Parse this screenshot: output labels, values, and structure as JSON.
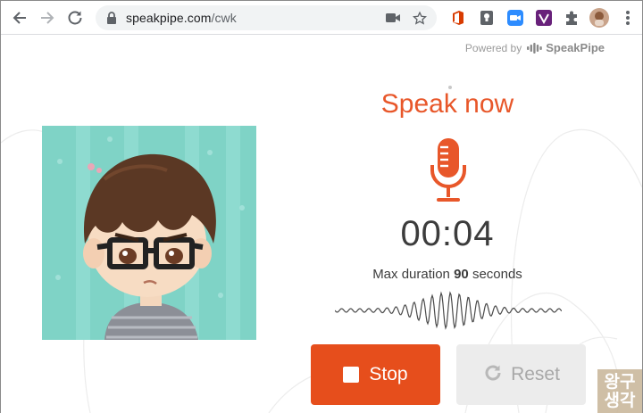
{
  "browser": {
    "url_domain": "speakpipe.com",
    "url_path": "/cwk",
    "icons": [
      "back-icon",
      "forward-icon",
      "reload-icon",
      "lock-icon",
      "camera-icon",
      "star-icon",
      "office-icon",
      "keep-icon",
      "zoom-icon",
      "vstudio-icon",
      "extensions-icon",
      "profile-icon",
      "menu-icon"
    ]
  },
  "page": {
    "powered_by": "Powered by",
    "brand": "SpeakPipe",
    "heading": "Speak now",
    "timer": "00:04",
    "max_duration_prefix": "Max duration",
    "max_duration_value": "90",
    "max_duration_suffix": "seconds",
    "stop_label": "Stop",
    "reset_label": "Reset"
  },
  "watermark": {
    "line1": "왕구",
    "line2": "생각"
  },
  "colors": {
    "accent": "#e64e1c",
    "heading": "#e8572a",
    "reset_bg": "#ececec",
    "avatar_bg": "#7fd3c6"
  }
}
